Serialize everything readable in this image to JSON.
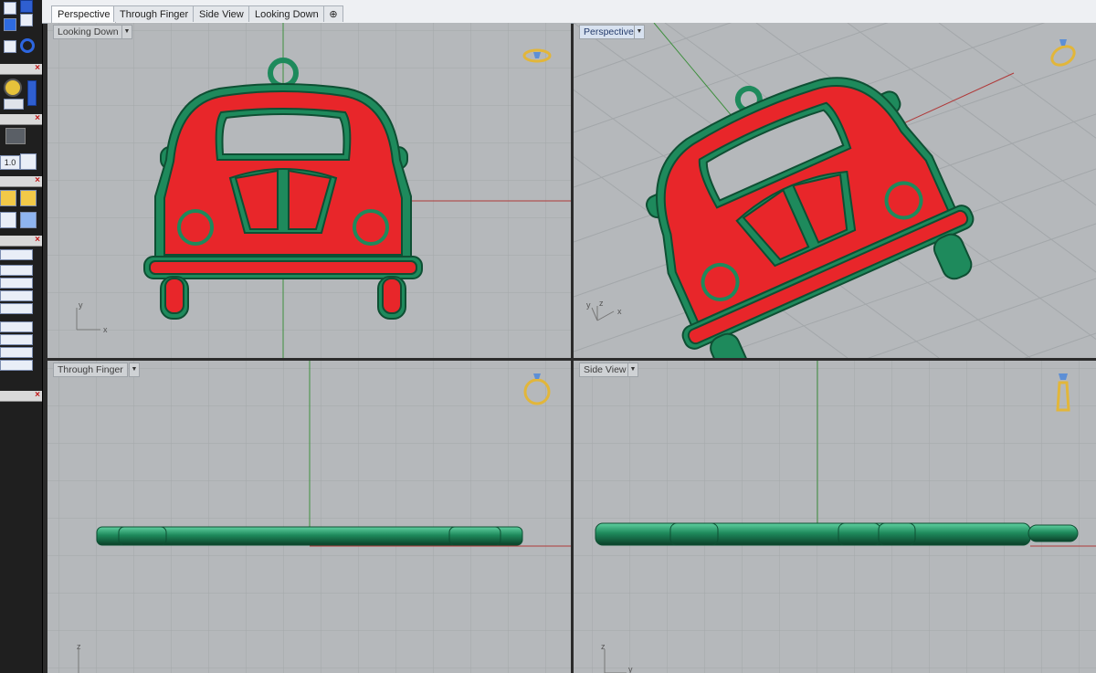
{
  "tabs": [
    {
      "label": "Perspective",
      "active": true
    },
    {
      "label": "Through Finger",
      "active": false
    },
    {
      "label": "Side View",
      "active": false
    },
    {
      "label": "Looking Down",
      "active": false
    }
  ],
  "tab_add_icon": "plus-icon",
  "viewports": {
    "top_left": {
      "title": "Looking Down",
      "axes": {
        "x": "x",
        "y": "y"
      }
    },
    "top_right": {
      "title": "Perspective",
      "axes": {
        "x": "x",
        "y": "y",
        "z": "z"
      }
    },
    "bottom_left": {
      "title": "Through Finger",
      "axes": {
        "z": "z"
      }
    },
    "bottom_right": {
      "title": "Side View",
      "axes": {
        "z": "z",
        "y": "y"
      }
    }
  },
  "left_toolbar": {
    "value_label": "1.0"
  },
  "colors": {
    "viewport_bg": "#b5b8bb",
    "grid": "#a3a7aa",
    "model_green": "#1e8a5c",
    "model_red": "#e8262a",
    "x_axis": "#b03a3a",
    "y_axis": "#3f8f3f",
    "ring_icon": "#e2b63a",
    "active_title": "#d8e2f0"
  }
}
